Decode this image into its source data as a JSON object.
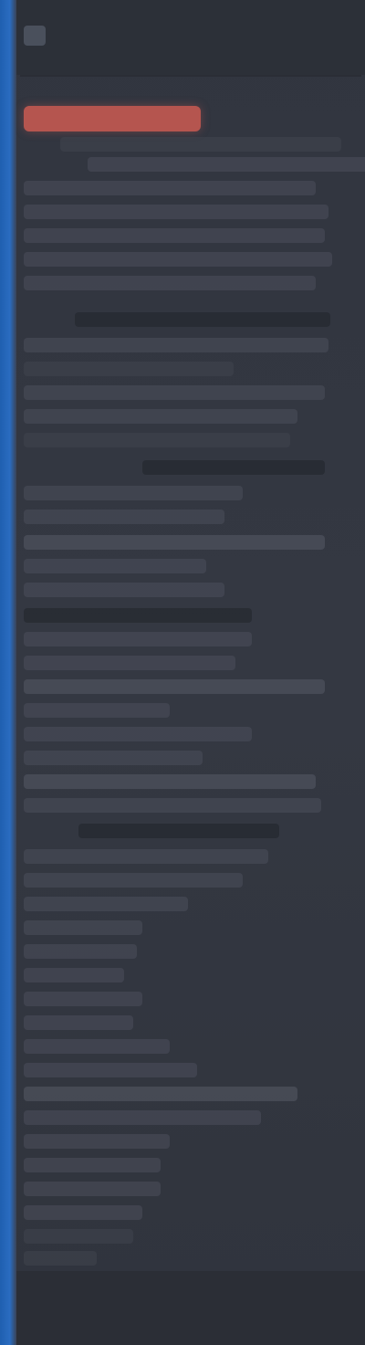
{
  "window": {
    "title": "",
    "accent_color": "#2a6cc0",
    "highlight_color": "#b5554f"
  },
  "highlight": {
    "label": ""
  },
  "icons": {
    "app_icon": "app-icon"
  }
}
